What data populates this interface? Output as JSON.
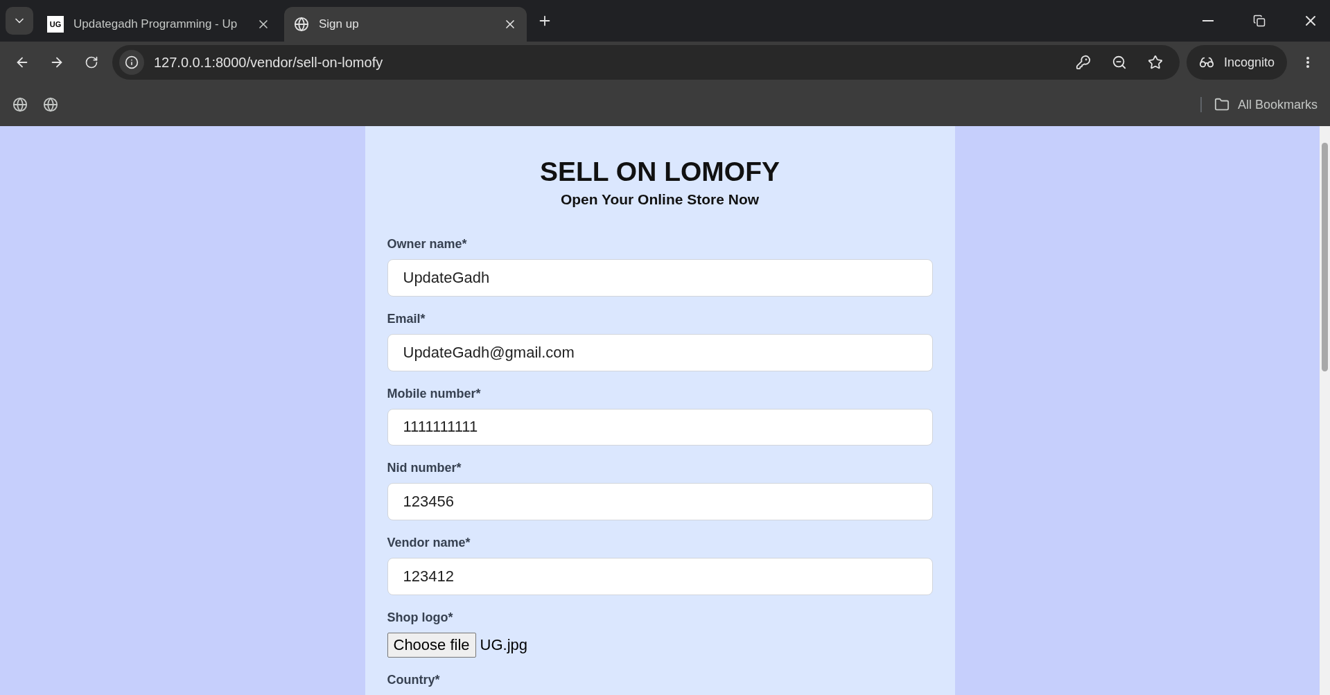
{
  "browser": {
    "tabs": [
      {
        "title": "Updategadh Programming - Up",
        "kind": "logo",
        "favicon_text": "UG",
        "selected": false
      },
      {
        "title": "Sign up",
        "kind": "globe",
        "selected": true
      }
    ],
    "address": "127.0.0.1:8000/vendor/sell-on-lomofy",
    "profile": "Incognito",
    "bookmarks_label": "All Bookmarks"
  },
  "form": {
    "title": "SELL ON LOMOFY",
    "subtitle": "Open Your Online Store Now",
    "fields": [
      {
        "kind": "text",
        "label": "Owner name*",
        "value": "UpdateGadh"
      },
      {
        "kind": "text",
        "label": "Email*",
        "value": "UpdateGadh@gmail.com"
      },
      {
        "kind": "text",
        "label": "Mobile number*",
        "value": "1111111111"
      },
      {
        "kind": "text",
        "label": "Nid number*",
        "value": "123456"
      },
      {
        "kind": "text",
        "label": "Vendor name*",
        "value": "123412"
      },
      {
        "kind": "file",
        "label": "Shop logo*",
        "button": "Choose file",
        "value": "UG.jpg"
      },
      {
        "kind": "label",
        "label": "Country*"
      }
    ]
  }
}
